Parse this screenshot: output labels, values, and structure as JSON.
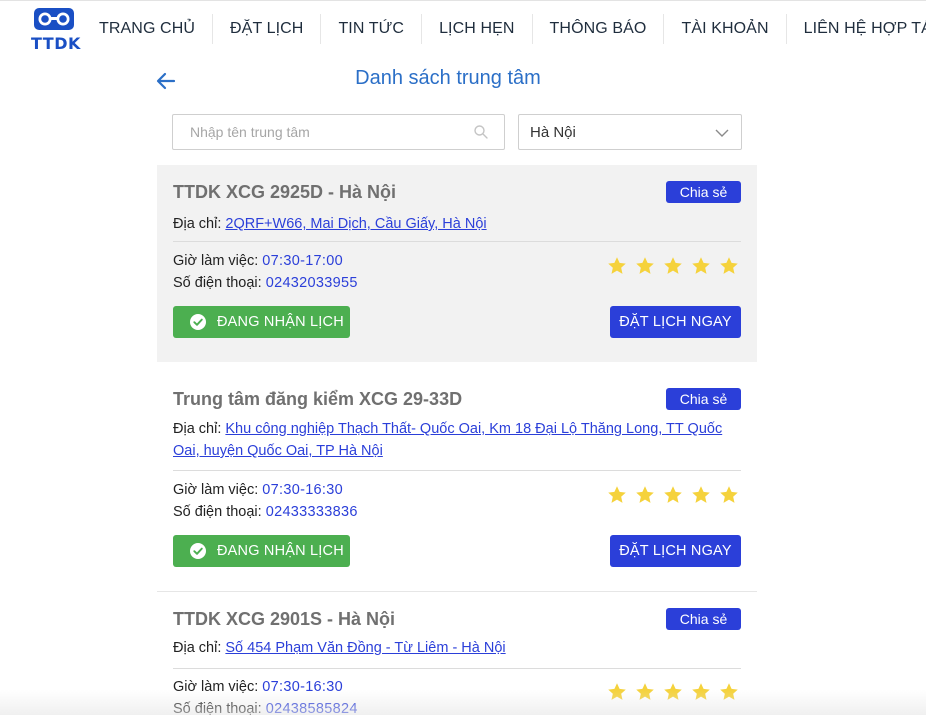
{
  "header": {
    "logo_text": "TTDK",
    "nav": [
      "TRANG CHỦ",
      "ĐẶT LỊCH",
      "TIN TỨC",
      "LỊCH HẸN",
      "THÔNG BÁO",
      "TÀI KHOẢN",
      "LIÊN HỆ HỢP TÁC"
    ]
  },
  "page": {
    "title": "Danh sách trung tâm"
  },
  "filters": {
    "search_placeholder": "Nhập tên trung tâm",
    "city_value": "Hà Nội"
  },
  "labels": {
    "share": "Chia sẻ",
    "address_prefix": "Địa chỉ:",
    "hours_prefix": "Giờ làm việc:",
    "phone_prefix": "Số điện thoại:",
    "status": "ĐANG NHẬN LỊCH",
    "book": "ĐẶT LỊCH NGAY"
  },
  "centers": [
    {
      "name": "TTDK XCG 2925D - Hà Nội",
      "address": "2QRF+W66, Mai Dịch, Cầu Giấy, Hà Nội",
      "hours": "07:30-17:00",
      "phone": "02432033955",
      "rating": 5
    },
    {
      "name": "Trung tâm đăng kiểm XCG 29-33D",
      "address": "Khu công nghiệp Thạch Thất- Quốc Oai, Km 18 Đại Lộ Thăng Long, TT Quốc Oai, huyện Quốc Oai, TP Hà Nội",
      "hours": "07:30-16:30",
      "phone": "02433333836",
      "rating": 5
    },
    {
      "name": "TTDK XCG 2901S - Hà Nội",
      "address": "Số 454 Phạm Văn Đồng - Từ Liêm - Hà Nội",
      "hours": "07:30-16:30",
      "phone": "02438585824",
      "rating": 5
    }
  ],
  "colors": {
    "brand_blue": "#2b3fd9",
    "title_blue": "#2b6fc7",
    "status_green": "#4caf50",
    "star_yellow": "#f5d23c",
    "card_highlight": "#f2f2f2"
  }
}
